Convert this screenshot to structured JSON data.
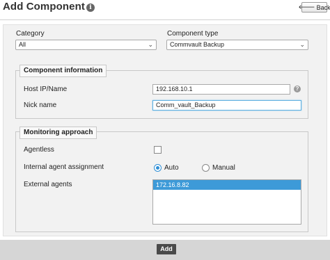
{
  "header": {
    "title": "Add Component",
    "info_icon": "info-icon",
    "back_label": "Back",
    "back_icon": "arrow-left-icon"
  },
  "filters": {
    "category_label": "Category",
    "category_value": "All",
    "component_type_label": "Component type",
    "component_type_value": "Commvault Backup"
  },
  "component_info": {
    "legend": "Component information",
    "host_label": "Host IP/Name",
    "host_value": "192.168.10.1",
    "nick_label": "Nick name",
    "nick_value": "Comm_vault_Backup",
    "help_icon": "help-icon"
  },
  "monitoring": {
    "legend": "Monitoring approach",
    "agentless_label": "Agentless",
    "agentless_checked": false,
    "assignment_label": "Internal agent assignment",
    "auto_label": "Auto",
    "manual_label": "Manual",
    "assignment_selected": "Auto",
    "external_label": "External agents",
    "external_agents": [
      "172.16.8.82"
    ]
  },
  "footer": {
    "add_label": "Add"
  },
  "colors": {
    "accent": "#3d9ad8",
    "footer_bg": "#d6d6d6",
    "panel_bg": "#f2f2f2",
    "add_button_bg": "#4a4a4a"
  }
}
